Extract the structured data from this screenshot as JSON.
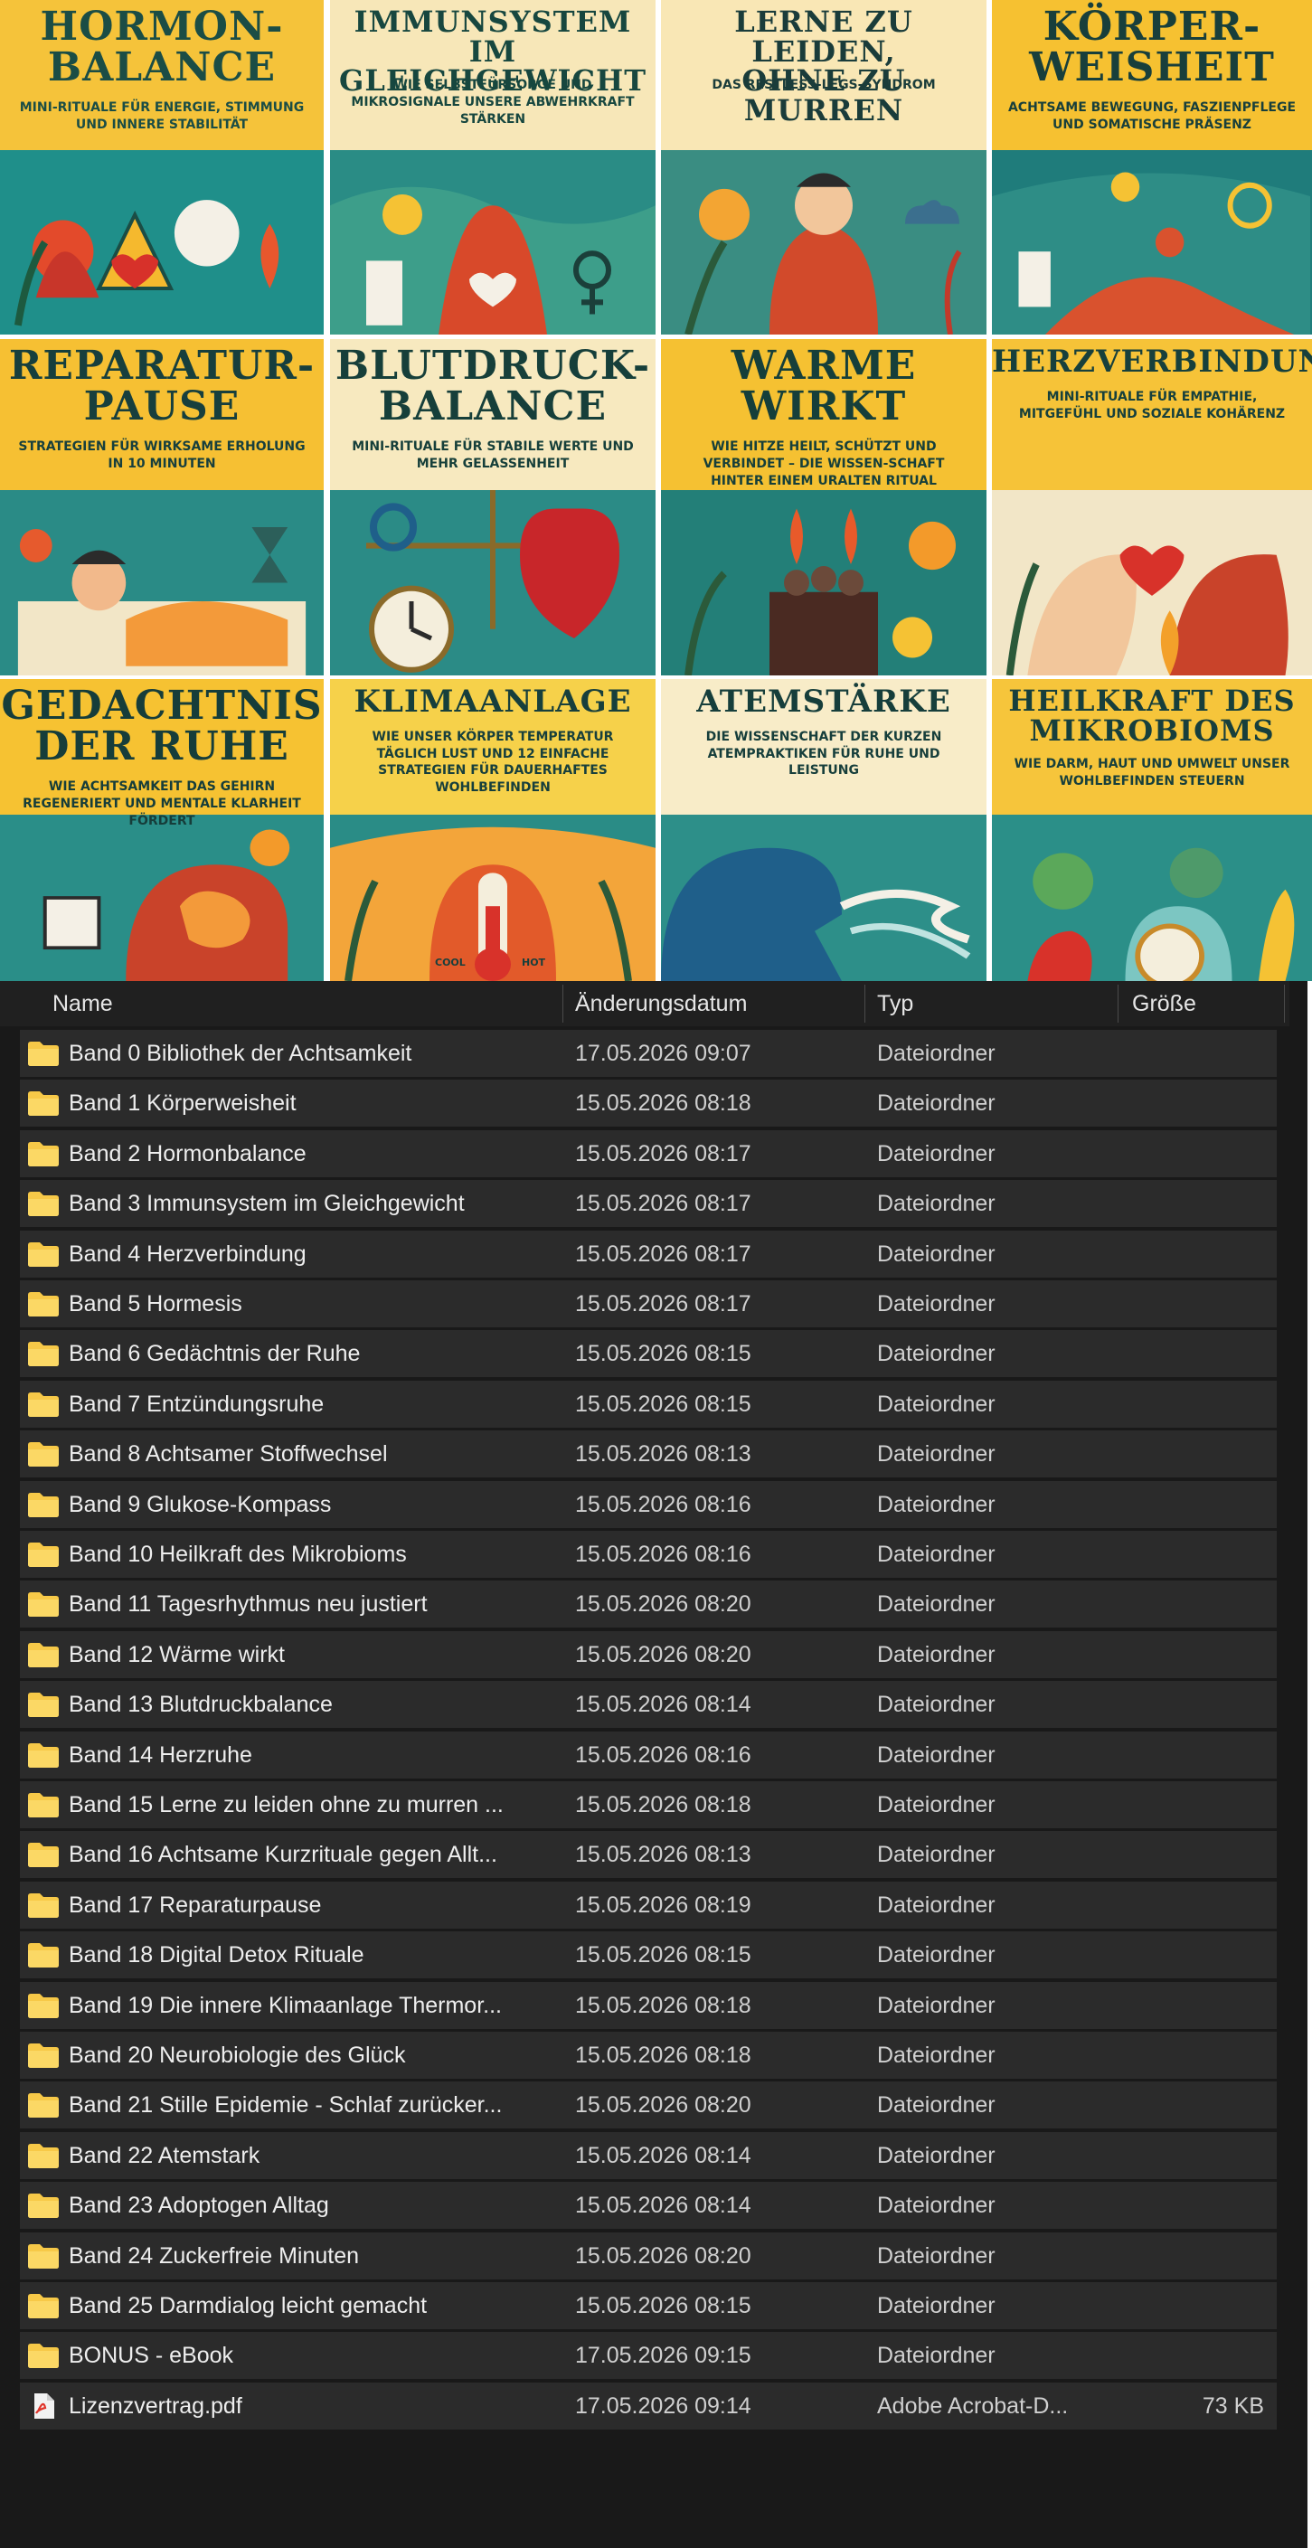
{
  "covers": [
    {
      "title": "HORMON-\nBALANCE",
      "subtitle": "MINI-RITUALE FÜR ENERGIE, STIMMUNG UND INNERE STABILITÄT",
      "bg": "#f5c33a",
      "bottom": "#1f8f8a",
      "title_color": "#1b4d45",
      "art": "hormon"
    },
    {
      "title": "IMMUNSYSTEM\nIM GLEICHGEWICHT",
      "subtitle": "WIE SELBSTFÜRSORGE UND MIKROSIGNALE UNSERE ABWEHRKRAFT STÄRKEN",
      "bg": "#f7e7b8",
      "bottom": "#2a8c85",
      "title_color": "#17473f",
      "art": "immun"
    },
    {
      "title": "LERNE ZU LEIDEN,\nOHNE ZU MURREN",
      "subtitle": "DAS RESTLESS-LEGS-SYNDROM",
      "bg": "#f9e7b5",
      "bottom": "#3a8d82",
      "title_color": "#1a3c3a",
      "art": "leiden"
    },
    {
      "title": "KÖRPER-\nWEISHEIT",
      "subtitle": "ACHTSAME BEWEGUNG, FASZIENPFLEGE UND SOMATISCHE PRÄSENZ",
      "bg": "#f6c131",
      "bottom": "#1f7c7b",
      "title_color": "#183f3b",
      "art": "koerper"
    },
    {
      "title": "REPARATUR-\nPAUSE",
      "subtitle": "STRATEGIEN FÜR WIRKSAME ERHOLUNG IN 10 MINUTEN",
      "bg": "#f6c033",
      "bottom": "#2a8b86",
      "title_color": "#173f3d",
      "art": "reparatur"
    },
    {
      "title": "BLUTDRUCK-\nBALANCE",
      "subtitle": "MINI-RITUALE FÜR STABILE WERTE UND MEHR GELASSENHEIT",
      "bg": "#f7e9bf",
      "bottom": "#2b8b86",
      "title_color": "#163f3a",
      "art": "blutdruck"
    },
    {
      "title": "WARME\nWIRKT",
      "subtitle": "WIE HITZE HEILT, SCHÜTZT UND VERBINDET – DIE WISSEN-SCHAFT HINTER EINEM URALTEN RITUAL",
      "bg": "#f5c132",
      "bottom": "#237f78",
      "title_color": "#163f3a",
      "art": "waerme"
    },
    {
      "title": "HERZVERBINDUNG",
      "subtitle": "MINI-RITUALE FÜR EMPATHIE, MITGEFÜHL UND SOZIALE KOHÄRENZ",
      "bg": "#f6c338",
      "bottom": "#f2e6c7",
      "title_color": "#17403c",
      "art": "herz"
    },
    {
      "title": "GEDACHTNIS\nDER RUHE",
      "subtitle": "WIE ACHTSAMKEIT DAS GEHIRN REGENERIERT UND MENTALE KLARHEIT FÖRDERT",
      "bg": "#f6c232",
      "bottom": "#2a8e88",
      "title_color": "#163d3a",
      "art": "gedaechtnis"
    },
    {
      "title": "KLIMAANLAGE",
      "subtitle": "WIE UNSER KÖRPER TEMPERATUR TÄGLICH LUST UND 12 EINFACHE STRATEGIEN FÜR DAUERHAFTES WOHLBEFINDEN",
      "bg": "#f6d14a",
      "bottom": "#2a8c86",
      "title_color": "#173f3c",
      "art": "klima",
      "cool_label": "COOL",
      "hot_label": "HOT"
    },
    {
      "title": "ATEMSTÄRKE",
      "subtitle": "DIE WISSENSCHAFT DER KURZEN ATEMPRAKTIKEN FÜR RUHE UND LEISTUNG",
      "bg": "#f8ecc8",
      "bottom": "#2d8f89",
      "title_color": "#163e3b",
      "art": "atem"
    },
    {
      "title": "HEILKRAFT DES\nMIKROBIOMS",
      "subtitle": "WIE DARM, HAUT UND UMWELT UNSER WOHLBEFINDEN STEUERN",
      "bg": "#f6c53b",
      "bottom": "#2b8f88",
      "title_color": "#173f3c",
      "art": "mikro"
    }
  ],
  "explorer": {
    "columns": {
      "name": "Name",
      "date": "Änderungsdatum",
      "type": "Typ",
      "size": "Größe"
    },
    "colors": {
      "folder": "#f7c948",
      "row_bg": "#2b2b2b",
      "panel_bg": "#191919",
      "pdf": "#e0352b"
    },
    "items": [
      {
        "name": "Band 0 Bibliothek der Achtsamkeit",
        "date": "17.05.2026 09:07",
        "type": "Dateiordner",
        "size": "",
        "icon": "folder-icon"
      },
      {
        "name": "Band 1 Körperweisheit",
        "date": "15.05.2026 08:18",
        "type": "Dateiordner",
        "size": "",
        "icon": "folder-icon"
      },
      {
        "name": "Band 2 Hormonbalance",
        "date": "15.05.2026 08:17",
        "type": "Dateiordner",
        "size": "",
        "icon": "folder-icon"
      },
      {
        "name": "Band 3 Immunsystem im Gleichgewicht",
        "date": "15.05.2026 08:17",
        "type": "Dateiordner",
        "size": "",
        "icon": "folder-icon"
      },
      {
        "name": "Band 4 Herzverbindung",
        "date": "15.05.2026 08:17",
        "type": "Dateiordner",
        "size": "",
        "icon": "folder-icon"
      },
      {
        "name": "Band 5 Hormesis",
        "date": "15.05.2026 08:17",
        "type": "Dateiordner",
        "size": "",
        "icon": "folder-icon"
      },
      {
        "name": "Band 6 Gedächtnis der Ruhe",
        "date": "15.05.2026 08:15",
        "type": "Dateiordner",
        "size": "",
        "icon": "folder-icon"
      },
      {
        "name": "Band 7 Entzündungsruhe",
        "date": "15.05.2026 08:15",
        "type": "Dateiordner",
        "size": "",
        "icon": "folder-icon"
      },
      {
        "name": "Band 8 Achtsamer Stoffwechsel",
        "date": "15.05.2026 08:13",
        "type": "Dateiordner",
        "size": "",
        "icon": "folder-icon"
      },
      {
        "name": "Band 9 Glukose-Kompass",
        "date": "15.05.2026 08:16",
        "type": "Dateiordner",
        "size": "",
        "icon": "folder-icon"
      },
      {
        "name": "Band 10 Heilkraft des Mikrobioms",
        "date": "15.05.2026 08:16",
        "type": "Dateiordner",
        "size": "",
        "icon": "folder-icon"
      },
      {
        "name": "Band 11 Tagesrhythmus neu justiert",
        "date": "15.05.2026 08:20",
        "type": "Dateiordner",
        "size": "",
        "icon": "folder-icon"
      },
      {
        "name": "Band 12 Wärme wirkt",
        "date": "15.05.2026 08:20",
        "type": "Dateiordner",
        "size": "",
        "icon": "folder-icon"
      },
      {
        "name": "Band 13 Blutdruckbalance",
        "date": "15.05.2026 08:14",
        "type": "Dateiordner",
        "size": "",
        "icon": "folder-icon"
      },
      {
        "name": "Band 14 Herzruhe",
        "date": "15.05.2026 08:16",
        "type": "Dateiordner",
        "size": "",
        "icon": "folder-icon"
      },
      {
        "name": "Band 15 Lerne zu leiden ohne zu murren ...",
        "date": "15.05.2026 08:18",
        "type": "Dateiordner",
        "size": "",
        "icon": "folder-icon"
      },
      {
        "name": "Band 16 Achtsame Kurzrituale gegen Allt...",
        "date": "15.05.2026 08:13",
        "type": "Dateiordner",
        "size": "",
        "icon": "folder-icon"
      },
      {
        "name": "Band 17 Reparaturpause",
        "date": "15.05.2026 08:19",
        "type": "Dateiordner",
        "size": "",
        "icon": "folder-icon"
      },
      {
        "name": "Band 18 Digital Detox Rituale",
        "date": "15.05.2026 08:15",
        "type": "Dateiordner",
        "size": "",
        "icon": "folder-icon"
      },
      {
        "name": "Band 19 Die innere Klimaanlage Thermor...",
        "date": "15.05.2026 08:18",
        "type": "Dateiordner",
        "size": "",
        "icon": "folder-icon"
      },
      {
        "name": "Band 20 Neurobiologie des Glück",
        "date": "15.05.2026 08:18",
        "type": "Dateiordner",
        "size": "",
        "icon": "folder-icon"
      },
      {
        "name": "Band 21 Stille Epidemie - Schlaf zurücker...",
        "date": "15.05.2026 08:20",
        "type": "Dateiordner",
        "size": "",
        "icon": "folder-icon"
      },
      {
        "name": "Band 22 Atemstark",
        "date": "15.05.2026 08:14",
        "type": "Dateiordner",
        "size": "",
        "icon": "folder-icon"
      },
      {
        "name": "Band 23 Adoptogen Alltag",
        "date": "15.05.2026 08:14",
        "type": "Dateiordner",
        "size": "",
        "icon": "folder-icon"
      },
      {
        "name": "Band 24 Zuckerfreie Minuten",
        "date": "15.05.2026 08:20",
        "type": "Dateiordner",
        "size": "",
        "icon": "folder-icon"
      },
      {
        "name": "Band 25 Darmdialog leicht gemacht",
        "date": "15.05.2026 08:15",
        "type": "Dateiordner",
        "size": "",
        "icon": "folder-icon"
      },
      {
        "name": "BONUS - eBook",
        "date": "17.05.2026 09:15",
        "type": "Dateiordner",
        "size": "",
        "icon": "folder-icon"
      },
      {
        "name": "Lizenzvertrag.pdf",
        "date": "17.05.2026 09:14",
        "type": "Adobe Acrobat-D...",
        "size": "73 KB",
        "icon": "pdf-icon"
      }
    ]
  }
}
